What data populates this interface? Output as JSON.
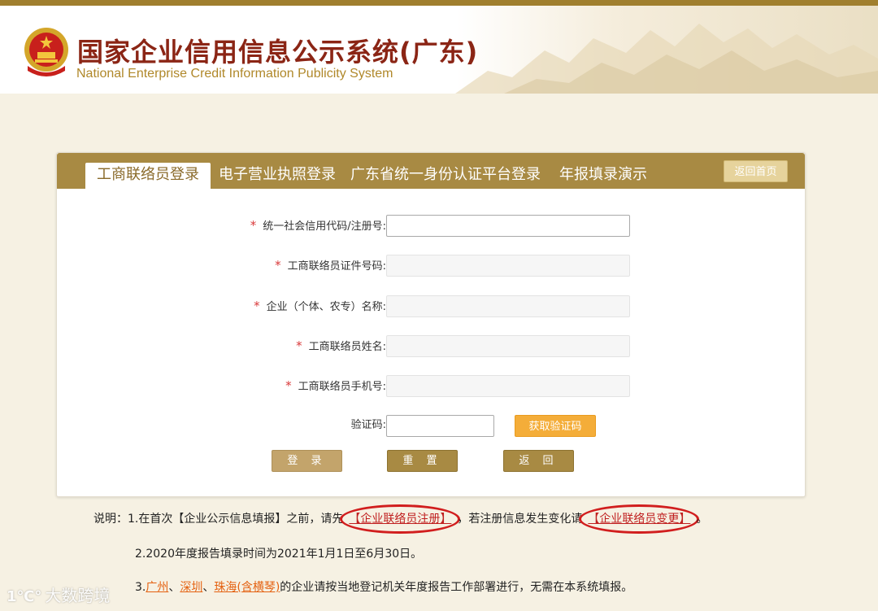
{
  "header": {
    "title": "国家企业信用信息公示系统(广东)",
    "subtitle": "National Enterprise Credit Information Publicity System"
  },
  "tabs": [
    {
      "label": "工商联络员登录",
      "active": true
    },
    {
      "label": "电子营业执照登录",
      "active": false
    },
    {
      "label": "广东省统一身份认证平台登录",
      "active": false
    },
    {
      "label": "年报填录演示",
      "active": false
    }
  ],
  "home_button": "返回首页",
  "form": {
    "required_mark": "*",
    "fields": [
      {
        "label": "统一社会信用代码/注册号:",
        "value": "",
        "enabled": true
      },
      {
        "label": "工商联络员证件号码:",
        "value": "",
        "enabled": false
      },
      {
        "label": "企业（个体、农专）名称:",
        "value": "",
        "enabled": false
      },
      {
        "label": "工商联络员姓名:",
        "value": "",
        "enabled": false
      },
      {
        "label": "工商联络员手机号:",
        "value": "",
        "enabled": false
      }
    ],
    "captcha_label": "验证码:",
    "captcha_value": "",
    "get_code_button": "获取验证码",
    "login_button": "登 录",
    "reset_button": "重 置",
    "back_button": "返 回"
  },
  "notes": {
    "line1_prefix": "说明：1.在首次【企业公示信息填报】之前，请先",
    "register_link": "【企业联络员注册】",
    "line1_middle": "，若注册信息发生变化请",
    "change_link": "【企业联络员变更】",
    "line1_suffix": "。",
    "line2": "2.2020年度报告填录时间为2021年1月1日至6月30日。",
    "line3_prefix": "3.",
    "city1": "广州",
    "sep1": "、",
    "city2": "深圳",
    "sep2": "、",
    "city3": "珠海(含横琴)",
    "line3_suffix": "的企业请按当地登记机关年度报告工作部署进行，无需在本系统填报。"
  },
  "watermark": {
    "logo": "1℃°",
    "text": "大数跨境"
  },
  "colors": {
    "brand_gold": "#a88a43",
    "title_red": "#8b2515",
    "required_red": "#d9393a",
    "link_orange": "#e4600f",
    "captcha_orange": "#f4ad39",
    "annotation_red": "#d11e1e"
  }
}
